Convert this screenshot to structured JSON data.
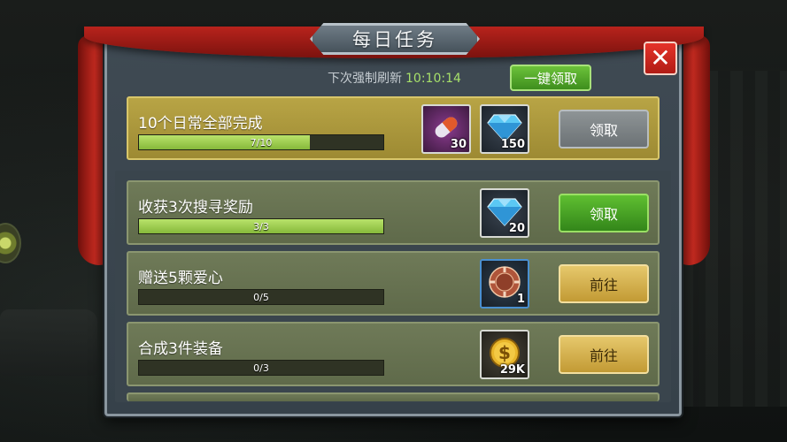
{
  "panel": {
    "title": "每日任务",
    "close_icon": "close-icon",
    "refresh_label": "下次强制刷新",
    "refresh_time": "10:10:14",
    "claim_all_label": "一键领取"
  },
  "tasks": [
    {
      "title": "10个日常全部完成",
      "progress_text": "7/10",
      "progress": 0.7,
      "rewards": [
        {
          "icon": "pill-capsule-icon",
          "qty": "30"
        },
        {
          "icon": "diamond-icon",
          "qty": "150"
        }
      ],
      "button_label": "领取",
      "button_style": "grey"
    },
    {
      "title": "收获3次搜寻奖励",
      "progress_text": "3/3",
      "progress": 1.0,
      "rewards": [
        {
          "icon": "diamond-icon",
          "qty": "20"
        }
      ],
      "button_label": "领取",
      "button_style": "green"
    },
    {
      "title": "赠送5颗爱心",
      "progress_text": "0/5",
      "progress": 0.0,
      "rewards": [
        {
          "icon": "poker-chip-icon",
          "qty": "1"
        }
      ],
      "button_label": "前往",
      "button_style": "gold"
    },
    {
      "title": "合成3件装备",
      "progress_text": "0/3",
      "progress": 0.0,
      "rewards": [
        {
          "icon": "gold-coin-icon",
          "qty": "29K"
        }
      ],
      "button_label": "前往",
      "button_style": "gold"
    }
  ],
  "colors": {
    "accent_green": "#5fbf31",
    "accent_gold": "#e6c86c",
    "close_red": "#e5332a",
    "timer_green": "#a7e06a"
  }
}
